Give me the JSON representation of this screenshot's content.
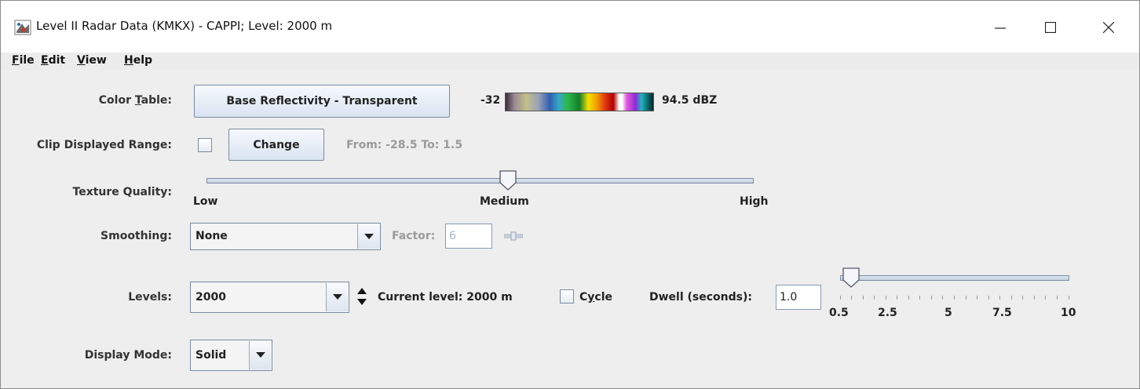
{
  "window": {
    "title": "Level II Radar Data (KMKX) - CAPPI; Level: 2000 m",
    "controls": {
      "minimize": "—",
      "maximize": "☐",
      "close": "✕"
    }
  },
  "menubar": {
    "items": [
      {
        "label": "File",
        "mnemonic": "F",
        "rest": "ile"
      },
      {
        "label": "Edit",
        "mnemonic": "E",
        "rest": "dit"
      },
      {
        "label": "View",
        "mnemonic": "V",
        "rest": "iew"
      },
      {
        "label": "Help",
        "mnemonic": "H",
        "rest": "elp"
      }
    ]
  },
  "color_table": {
    "label_pre": "Color ",
    "label_mnemonic": "T",
    "label_post": "able:",
    "button_label": "Base Reflectivity - Transparent",
    "range_min": "-32",
    "range_max": "94.5 dBZ"
  },
  "clip_range": {
    "label": "Clip Displayed Range:",
    "change_label": "Change",
    "range_text": "From: -28.5 To: 1.5",
    "checked": false
  },
  "texture": {
    "label": "Texture Quality:",
    "low": "Low",
    "medium": "Medium",
    "high": "High",
    "value_fraction": 0.55
  },
  "smoothing": {
    "label": "Smoothing:",
    "selected": "None",
    "factor_label": "Factor:",
    "factor_value": "6"
  },
  "levels": {
    "label": "Levels:",
    "selected": "2000",
    "current_level": "Current level: 2000 m",
    "cycle_pre": "C",
    "cycle_mnemonic": "y",
    "cycle_post": "cle",
    "dwell_label": "Dwell (seconds):",
    "dwell_value": "1.0",
    "slider_ticks": [
      "0.5",
      "2.5",
      "5",
      "7.5",
      "10"
    ],
    "slider_value": 1.0
  },
  "display_mode": {
    "label": "Display Mode:",
    "selected": "Solid"
  },
  "colors": {
    "button_top": "#f6f9fd",
    "button_bottom": "#d9e4f1",
    "border": "#7a8ba2",
    "muted_text": "#9a9a9a",
    "panel_bg": "#eeeeee"
  }
}
